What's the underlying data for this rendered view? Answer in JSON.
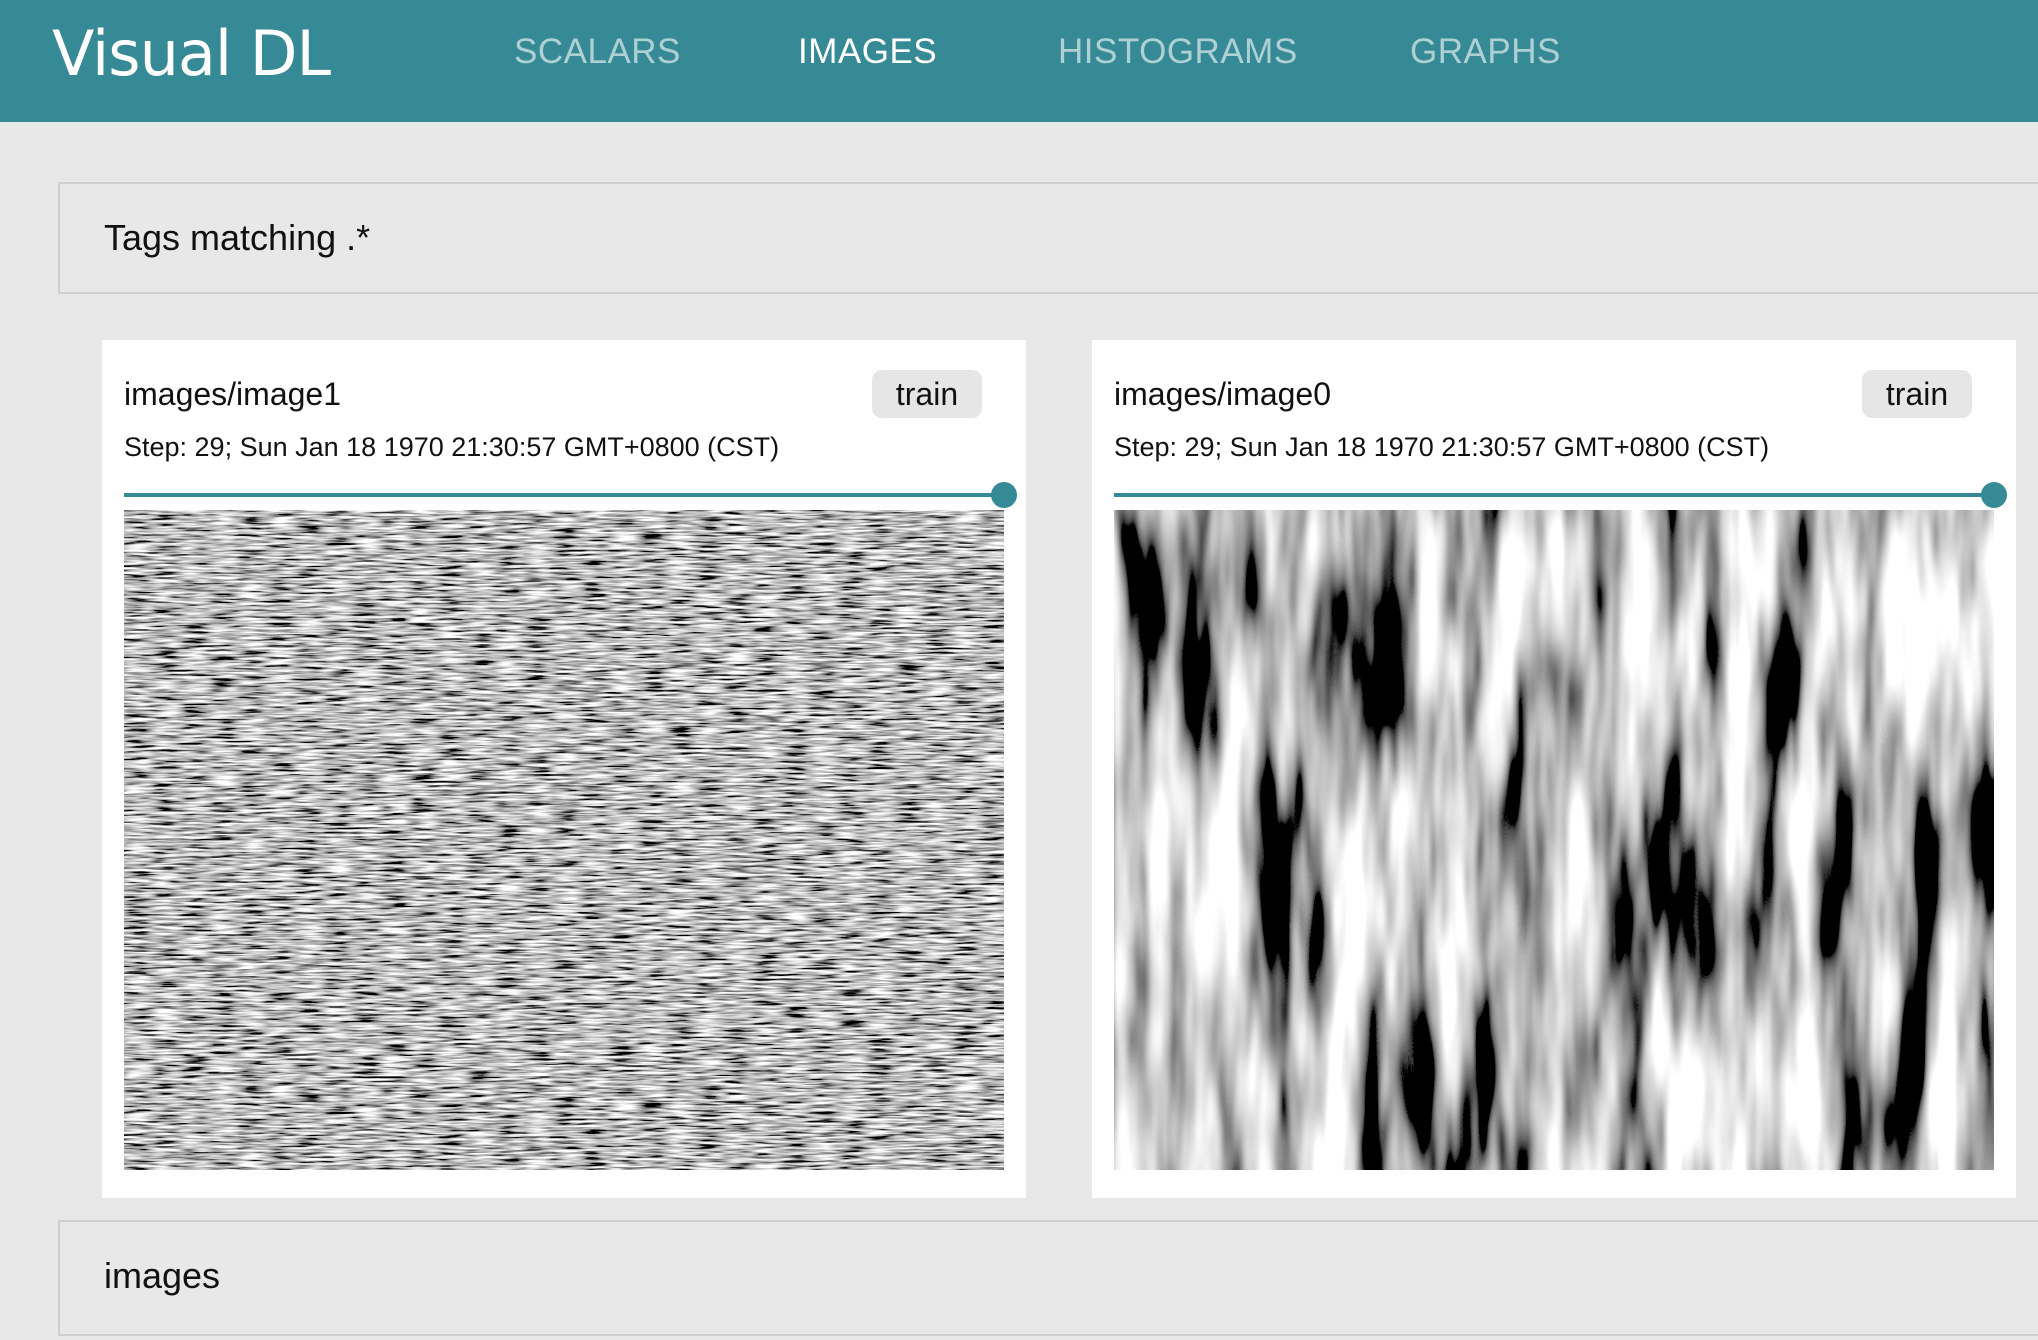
{
  "app": {
    "logo": "Visual DL"
  },
  "nav": {
    "items": [
      {
        "label": "SCALARS",
        "active": false
      },
      {
        "label": "IMAGES",
        "active": true
      },
      {
        "label": "HISTOGRAMS",
        "active": false
      },
      {
        "label": "GRAPHS",
        "active": false
      }
    ]
  },
  "tags_section": {
    "title": "Tags matching .*"
  },
  "cards": [
    {
      "title": "images/image1",
      "run": "train",
      "step_text": "Step: 29; Sun Jan 18 1970 21:30:57 GMT+0800 (CST)",
      "slider_value": 1.0,
      "image_style": "fine-noise"
    },
    {
      "title": "images/image0",
      "run": "train",
      "step_text": "Step: 29; Sun Jan 18 1970 21:30:57 GMT+0800 (CST)",
      "slider_value": 1.0,
      "image_style": "vertical-streaks"
    }
  ],
  "group_section": {
    "title": "images"
  },
  "colors": {
    "accent": "#358a95",
    "background": "#e8e8e8",
    "card": "#ffffff",
    "chip": "#e6e6e6"
  }
}
